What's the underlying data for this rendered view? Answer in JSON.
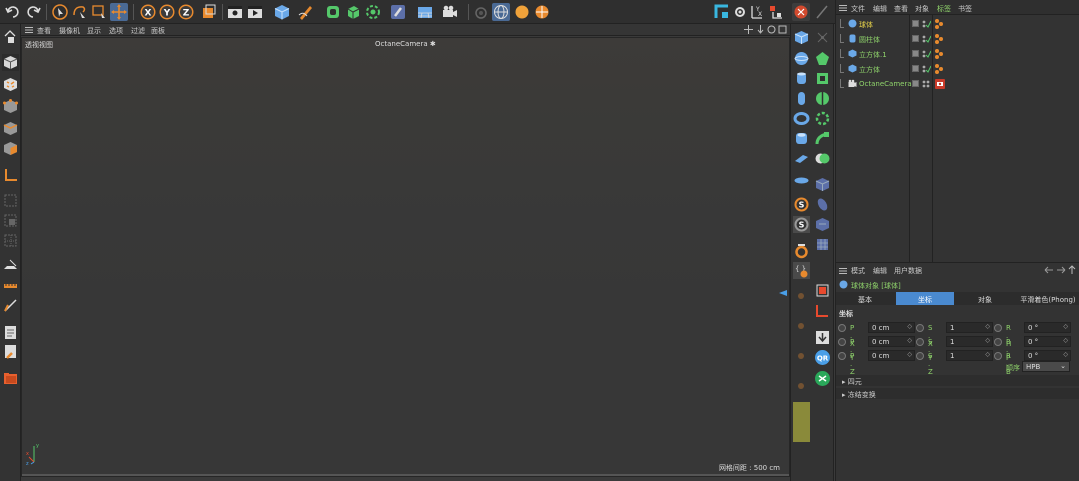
{
  "viewport_menu": [
    "查看",
    "摄像机",
    "显示",
    "选项",
    "过滤",
    "面板"
  ],
  "viewport": {
    "title": "透视视图",
    "camera": "OctaneCamera",
    "grid_spacing": "网格间距 : 500 cm"
  },
  "object_manager": {
    "menu": [
      "文件",
      "编辑",
      "查看",
      "对象",
      "标签",
      "书签"
    ],
    "objects": [
      {
        "name": "球体",
        "icon": "sphere-icon",
        "highlight": true
      },
      {
        "name": "圆柱体",
        "icon": "cylinder-icon"
      },
      {
        "name": "立方体.1",
        "icon": "cube-icon"
      },
      {
        "name": "立方体",
        "icon": "cube-icon"
      },
      {
        "name": "OctaneCamera",
        "icon": "camera-icon",
        "has_tag": true
      }
    ]
  },
  "attribute_manager": {
    "menu": [
      "模式",
      "编辑",
      "用户数据"
    ],
    "object_title": "球体对象 [球体]",
    "tabs": [
      "基本",
      "坐标",
      "对象",
      "平滑着色(Phong)"
    ],
    "active_tab": 1,
    "section_label": "坐标",
    "rows": [
      {
        "p_label": "P . X",
        "p_val": "0 cm",
        "s_label": "S . X",
        "s_val": "1",
        "r_label": "R . H",
        "r_val": "0 °"
      },
      {
        "p_label": "P . Y",
        "p_val": "0 cm",
        "s_label": "S . Y",
        "s_val": "1",
        "r_label": "R . P",
        "r_val": "0 °"
      },
      {
        "p_label": "P . Z",
        "p_val": "0 cm",
        "s_label": "S . Z",
        "s_val": "1",
        "r_label": "R . B",
        "r_val": "0 °"
      }
    ],
    "order_label": "顺序",
    "order_value": "HPB",
    "collapsed_sections": [
      "四元",
      "冻结变换"
    ]
  },
  "colors": {
    "accent": "#4a9fe8",
    "orange": "#e88a2e",
    "green_text": "#8fd36b",
    "yellow_text": "#e6d24a",
    "active_tab": "#4a8ad0"
  }
}
